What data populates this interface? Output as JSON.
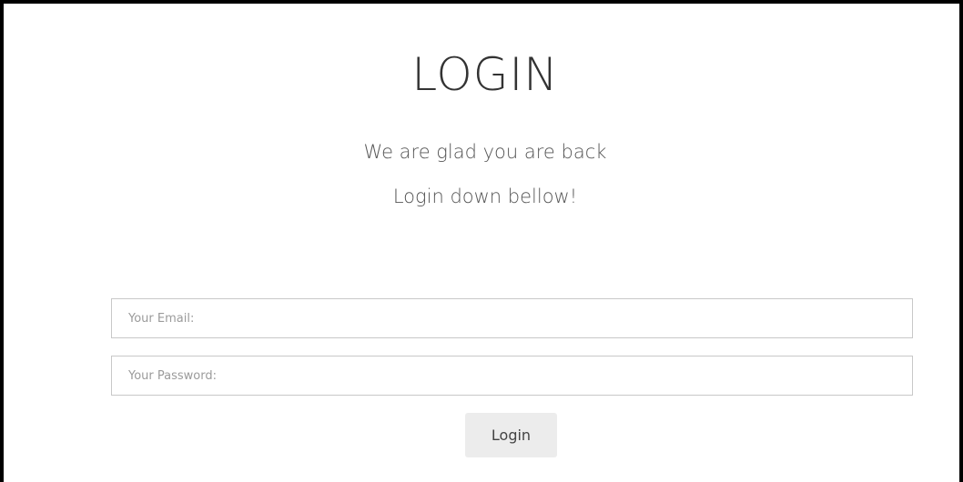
{
  "page": {
    "title": "LOGIN",
    "subtitle_line1": "We are glad you are back",
    "subtitle_line2": "Login down bellow!"
  },
  "form": {
    "email_placeholder": "Your Email:",
    "email_value": "",
    "password_placeholder": "Your Password:",
    "password_value": "",
    "submit_label": "Login"
  },
  "colors": {
    "border": "#000000",
    "button_bg": "#ececec",
    "input_border": "#c8c8c8"
  }
}
